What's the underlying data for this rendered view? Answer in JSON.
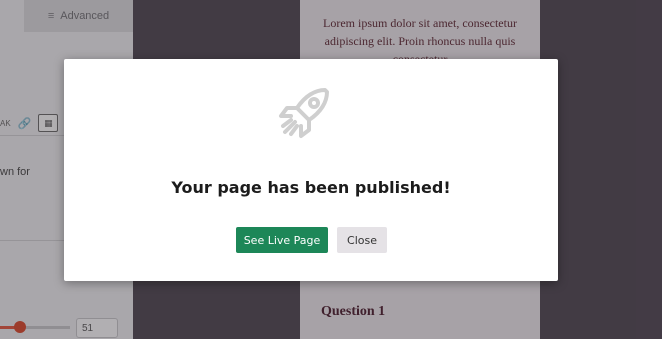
{
  "editor": {
    "advanced_tab": "Advanced",
    "text_fragment": "wn for",
    "toolbar_fragment": "AK",
    "slider_value": "51",
    "slider_level_fraction": 0.22
  },
  "preview": {
    "lorem": "Lorem ipsum dolor sit amet, consectetur adipiscing elit. Proin rhoncus nulla quis consectetur",
    "question": "Question 1"
  },
  "modal": {
    "icon": "rocket-icon",
    "title": "Your page has been published!",
    "primary_button": "See Live Page",
    "secondary_button": "Close"
  },
  "colors": {
    "primary_button": "#1d8758",
    "secondary_button": "#e5e2e6",
    "slider_accent": "#d2543f",
    "backdrop": "#4d4650"
  }
}
